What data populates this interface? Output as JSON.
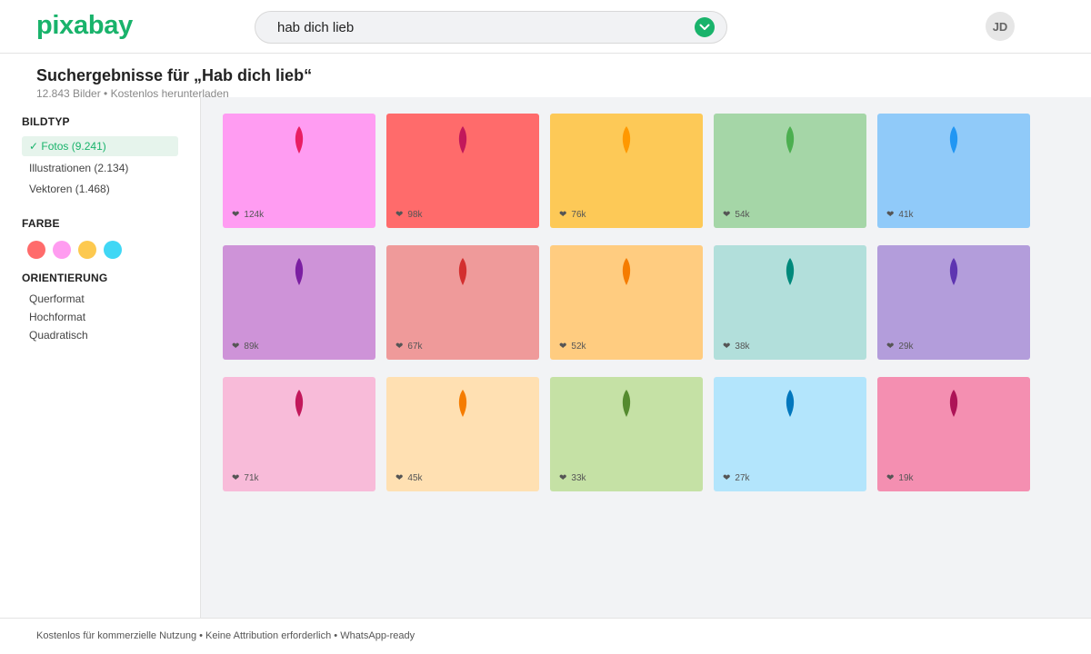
{
  "app": {
    "logo": "pixabay"
  },
  "search": {
    "query": "hab dich lieb"
  },
  "user": {
    "initials": "JD"
  },
  "results": {
    "title": "Suchergebnisse für „Hab dich lieb“",
    "subtitle": "12.843 Bilder • Kostenlos herunterladen"
  },
  "sidebar": {
    "bildtyp": {
      "title": "BILDTYP",
      "selected": "✓ Fotos (9.241)",
      "items": [
        "Illustrationen (2.134)",
        "Vektoren (1.468)"
      ]
    },
    "farbe": {
      "title": "FARBE",
      "swatches": [
        "#ff6b6b",
        "#ff9cf0",
        "#fdc94f",
        "#40d7f5"
      ]
    },
    "orientierung": {
      "title": "ORIENTIERUNG",
      "items": [
        "Querformat",
        "Hochformat",
        "Quadratisch"
      ]
    }
  },
  "grid": [
    {
      "bg": "#ff9cf2",
      "leaf": "#e91e63",
      "likes": "124k"
    },
    {
      "bg": "#ff6b6b",
      "leaf": "#c2185b",
      "likes": "98k"
    },
    {
      "bg": "#fdc957",
      "leaf": "#ff9800",
      "likes": "76k"
    },
    {
      "bg": "#a5d6a7",
      "leaf": "#4caf50",
      "likes": "54k"
    },
    {
      "bg": "#90caf9",
      "leaf": "#2196f3",
      "likes": "41k"
    },
    {
      "bg": "#ce93d8",
      "leaf": "#7b1fa2",
      "likes": "89k"
    },
    {
      "bg": "#ef9a9a",
      "leaf": "#d32f2f",
      "likes": "67k"
    },
    {
      "bg": "#ffcc80",
      "leaf": "#f57c00",
      "likes": "52k"
    },
    {
      "bg": "#b2dfdb",
      "leaf": "#00897b",
      "likes": "38k"
    },
    {
      "bg": "#b39ddb",
      "leaf": "#5e35b1",
      "likes": "29k"
    },
    {
      "bg": "#f8bbd9",
      "leaf": "#c2185b",
      "likes": "71k"
    },
    {
      "bg": "#ffe0b2",
      "leaf": "#f57c00",
      "likes": "45k"
    },
    {
      "bg": "#c5e1a5",
      "leaf": "#558b2f",
      "likes": "33k"
    },
    {
      "bg": "#b3e5fc",
      "leaf": "#0277bd",
      "likes": "27k"
    },
    {
      "bg": "#f48fb1",
      "leaf": "#ad1457",
      "likes": "19k"
    }
  ],
  "footer": {
    "text": "Kostenlos für kommerzielle Nutzung • Keine Attribution erforderlich • WhatsApp-ready"
  }
}
